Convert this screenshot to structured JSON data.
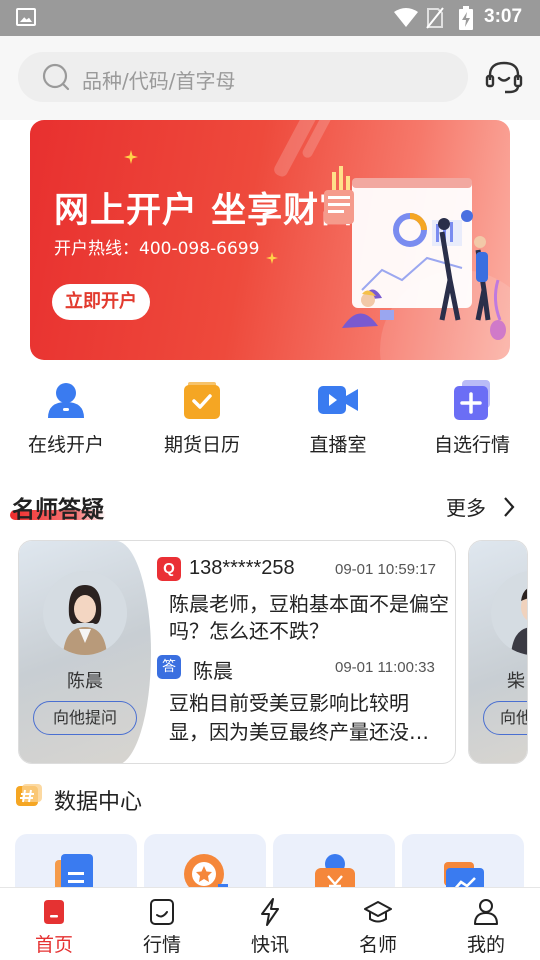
{
  "status_bar": {
    "time": "3:07"
  },
  "search": {
    "placeholder": "品种/代码/首字母"
  },
  "banner": {
    "title": "网上开户  坐享财富",
    "hotline": "开户热线：400-098-6699",
    "button": "立即开户"
  },
  "quick_entries": [
    {
      "label": "在线开户",
      "icon": "user-icon",
      "color": "#3a7bf0"
    },
    {
      "label": "期货日历",
      "icon": "calendar-check-icon",
      "color": "#f5a623"
    },
    {
      "label": "直播室",
      "icon": "video-camera-icon",
      "color": "#3a7bf0"
    },
    {
      "label": "自选行情",
      "icon": "plus-square-icon",
      "color": "#6b6ef5"
    }
  ],
  "qa_section": {
    "title": "名师答疑",
    "more": "更多",
    "cards": [
      {
        "teacher": "陈晨",
        "ask_button": "向他提问",
        "question": {
          "badge": "Q",
          "user": "138*****258",
          "time": "09-01 10:59:17",
          "text": "陈晨老师，豆粕基本面不是偏空吗？怎么还不跌？"
        },
        "answer": {
          "badge": "答",
          "user": "陈晨",
          "time": "09-01 11:00:33",
          "line1": "豆粕目前受美豆影响比较明",
          "line2": "显，因为美豆最终产量还没…"
        }
      },
      {
        "teacher": "柴",
        "ask_button": "向他"
      }
    ]
  },
  "data_center": {
    "title": "数据中心",
    "icon": "hash-tag-icon",
    "tiles": [
      "document-icon",
      "medal-icon",
      "money-bag-icon",
      "folder-chart-icon"
    ]
  },
  "tabbar": {
    "tabs": [
      {
        "label": "首页",
        "icon": "home-icon",
        "active": true
      },
      {
        "label": "行情",
        "icon": "chart-icon",
        "active": false
      },
      {
        "label": "快讯",
        "icon": "lightning-icon",
        "active": false
      },
      {
        "label": "名师",
        "icon": "graduation-cap-icon",
        "active": false
      },
      {
        "label": "我的",
        "icon": "person-icon",
        "active": false
      }
    ]
  },
  "colors": {
    "accent": "#e53232",
    "blue": "#3a6fe0",
    "banner": "#e8302f"
  }
}
